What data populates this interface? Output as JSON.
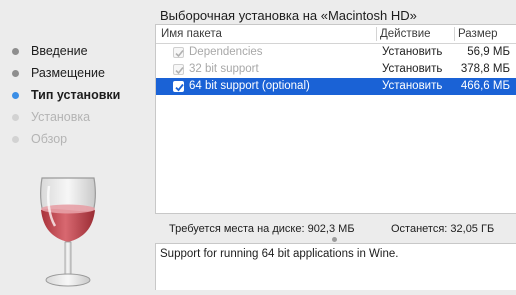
{
  "sidebar": {
    "steps": [
      {
        "label": "Введение",
        "state": "done"
      },
      {
        "label": "Размещение",
        "state": "done"
      },
      {
        "label": "Тип установки",
        "state": "current"
      },
      {
        "label": "Установка",
        "state": "future"
      },
      {
        "label": "Обзор",
        "state": "future"
      }
    ],
    "logo_icon": "wine-glass-icon"
  },
  "main": {
    "title": "Выборочная установка на «Macintosh HD»"
  },
  "table": {
    "headers": {
      "name": "Имя пакета",
      "action": "Действие",
      "size": "Размер"
    },
    "rows": [
      {
        "name": "Dependencies",
        "action": "Установить",
        "size": "56,9 МБ",
        "checked": true,
        "enabled": false,
        "selected": false
      },
      {
        "name": "32 bit support",
        "action": "Установить",
        "size": "378,8 МБ",
        "checked": true,
        "enabled": false,
        "selected": false
      },
      {
        "name": "64 bit support (optional)",
        "action": "Установить",
        "size": "466,6 МБ",
        "checked": true,
        "enabled": true,
        "selected": true
      }
    ]
  },
  "space": {
    "required": "Требуется места на диске:   902,3 МБ",
    "remaining": "Останется:   32,05 ГБ"
  },
  "description": "Support for running 64 bit applications in Wine.",
  "colors": {
    "accent": "#3a8ee6",
    "selection": "#1a62d6",
    "wine": "#c0484e"
  }
}
